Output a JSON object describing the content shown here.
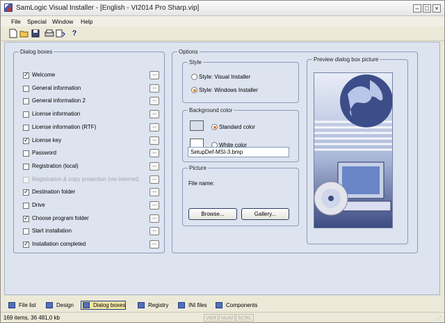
{
  "window": {
    "title": "SamLogic Visual Installer - [English - VI2014 Pro Sharp.vip]"
  },
  "menu": [
    "File",
    "Special",
    "Window",
    "Help"
  ],
  "toolbar": [
    "new-file-icon",
    "open-folder-icon",
    "save-icon",
    "print-icon",
    "compile-icon",
    "help-icon"
  ],
  "dialog_boxes": {
    "legend": "Dialog boxes",
    "items": [
      {
        "label": "Welcome",
        "checked": true,
        "disabled": false,
        "has_button": true
      },
      {
        "label": "General information",
        "checked": false,
        "disabled": false,
        "has_button": true
      },
      {
        "label": "General information 2",
        "checked": false,
        "disabled": false,
        "has_button": true
      },
      {
        "label": "License information",
        "checked": false,
        "disabled": false,
        "has_button": true
      },
      {
        "label": "License information (RTF)",
        "checked": false,
        "disabled": false,
        "has_button": true
      },
      {
        "label": "License key",
        "checked": true,
        "disabled": false,
        "has_button": true
      },
      {
        "label": "Password",
        "checked": false,
        "disabled": false,
        "has_button": true
      },
      {
        "label": "Registration (local)",
        "checked": false,
        "disabled": false,
        "has_button": true
      },
      {
        "label": "Registration & copy protection (via Internet)",
        "checked": false,
        "disabled": true,
        "has_button": true
      },
      {
        "label": "Destination folder",
        "checked": true,
        "disabled": false,
        "has_button": true
      },
      {
        "label": "Drive",
        "checked": false,
        "disabled": false,
        "has_button": true
      },
      {
        "label": "Choose program folder",
        "checked": true,
        "disabled": false,
        "has_button": true
      },
      {
        "label": "Start installation",
        "checked": false,
        "disabled": false,
        "has_button": true
      },
      {
        "label": "Installation completed",
        "checked": true,
        "disabled": false,
        "has_button": true
      }
    ],
    "button_label": "..."
  },
  "options": {
    "legend": "Options",
    "style": {
      "legend": "Style",
      "visual_installer": "Style: Visual Installer",
      "windows_installer": "Style: Windows Installer",
      "selected": "windows_installer"
    },
    "background": {
      "legend": "Background color",
      "standard": "Standard color",
      "white": "White color",
      "standard_color": "#d7dfec",
      "white_color": "#ffffff",
      "selected": "standard"
    },
    "picture": {
      "legend": "Picture",
      "file_name_label": "File name:",
      "file_name_value": "SetupDef-MSI-3.bmp",
      "browse": "Browse...",
      "gallery": "Gallery..."
    },
    "preview": {
      "legend": "Preview dialog box picture"
    }
  },
  "bottom_tabs": [
    {
      "label": "File list",
      "active": false
    },
    {
      "label": "Design",
      "active": false
    },
    {
      "label": "Dialog boxes",
      "active": true
    },
    {
      "label": "Registry",
      "active": false
    },
    {
      "label": "INI files",
      "active": false
    },
    {
      "label": "Components",
      "active": false
    }
  ],
  "status": {
    "summary": "169 items, 36 481,0 kb",
    "ver": "VER",
    "num": "NUM",
    "scrl": "SCRL"
  }
}
